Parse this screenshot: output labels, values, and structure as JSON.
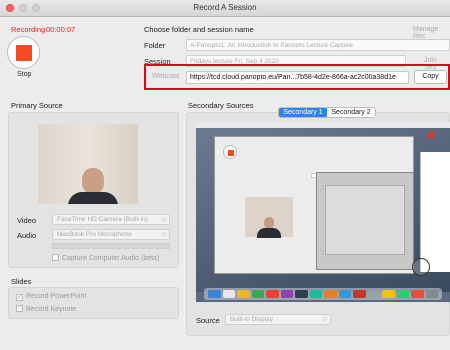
{
  "window": {
    "title": "Record A Session"
  },
  "recording": {
    "status": "Recording",
    "elapsed": "00:00:07",
    "stop_label": "Stop"
  },
  "session": {
    "header": "Choose folder and session name",
    "manage_link": "Manage Rec",
    "folder_label": "Folder",
    "folder_value": "A-Panopto1: An Introduction to Panopto Lecture Capture",
    "session_label": "Session",
    "session_value": "Fridays lecture Fri, Sep 4 2020",
    "join_link": "Join Ses",
    "webcast_label": "Webcast",
    "webcast_url": "https://tcd.cloud.panopto.eu/Pan...7b58-4d2e-866a-ac2c00a38d1e",
    "copy_label": "Copy"
  },
  "primary": {
    "header": "Primary Source",
    "video_label": "Video",
    "video_value": "FaceTime HD Camera (Built-in)",
    "audio_label": "Audio",
    "audio_value": "MacBook Pro Microphone",
    "capture_audio_label": "Capture Computer Audio (beta)"
  },
  "slides": {
    "header": "Slides",
    "record_powerpoint": "Record PowerPoint",
    "record_keynote": "Record Keynote"
  },
  "secondary": {
    "header": "Secondary Sources",
    "tabs": [
      "Secondary 1",
      "Secondary 2"
    ],
    "source_label": "Source",
    "source_value": "Built-in Display"
  },
  "colors": {
    "accent": "#2f84e9",
    "record": "#f24a24",
    "highlight": "#e8001a"
  }
}
